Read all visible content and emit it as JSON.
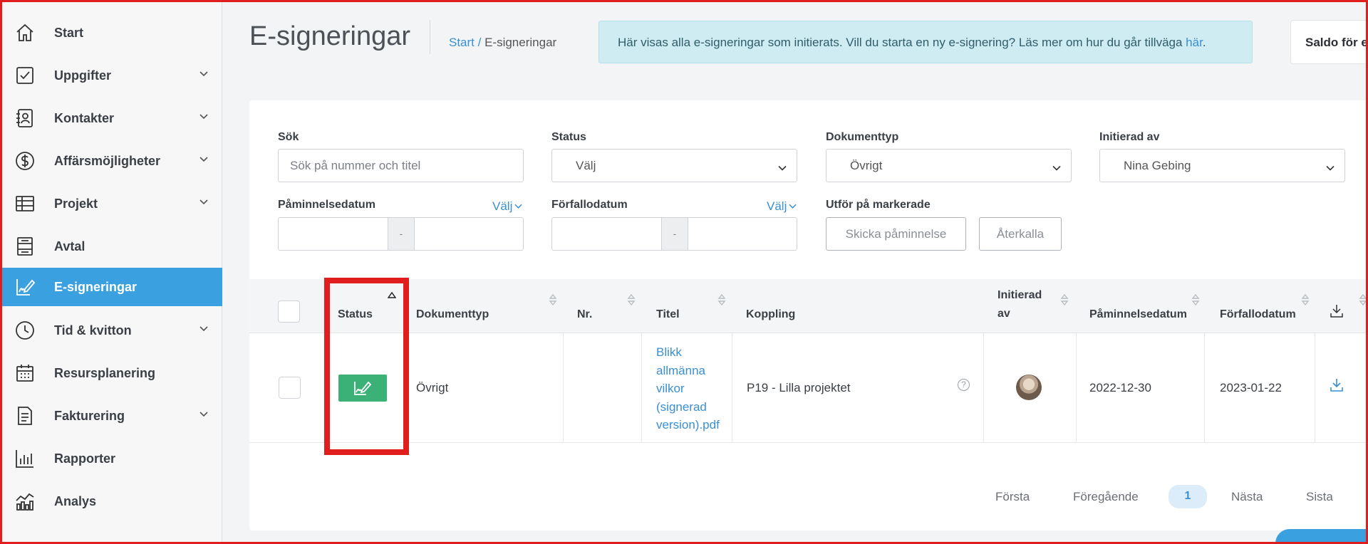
{
  "sidebar": {
    "items": [
      {
        "label": "Start",
        "icon": "home-icon",
        "has_chevron": false,
        "active": false
      },
      {
        "label": "Uppgifter",
        "icon": "checkbox-icon",
        "has_chevron": true,
        "active": false
      },
      {
        "label": "Kontakter",
        "icon": "contacts-icon",
        "has_chevron": true,
        "active": false
      },
      {
        "label": "Affärsmöjligheter",
        "icon": "dollar-icon",
        "has_chevron": true,
        "active": false
      },
      {
        "label": "Projekt",
        "icon": "table-icon",
        "has_chevron": true,
        "active": false
      },
      {
        "label": "Avtal",
        "icon": "contract-icon",
        "has_chevron": false,
        "active": false
      },
      {
        "label": "E-signeringar",
        "icon": "signature-icon",
        "has_chevron": false,
        "active": true
      },
      {
        "label": "Tid & kvitton",
        "icon": "clock-icon",
        "has_chevron": true,
        "active": false
      },
      {
        "label": "Resursplanering",
        "icon": "calendar-icon",
        "has_chevron": false,
        "active": false
      },
      {
        "label": "Fakturering",
        "icon": "document-icon",
        "has_chevron": true,
        "active": false
      },
      {
        "label": "Rapporter",
        "icon": "bar-chart-icon",
        "has_chevron": false,
        "active": false
      },
      {
        "label": "Analys",
        "icon": "analytics-icon",
        "has_chevron": false,
        "active": false
      }
    ]
  },
  "header": {
    "title": "E-signeringar",
    "breadcrumb_start": "Start",
    "breadcrumb_sep": " / ",
    "breadcrumb_current": "E-signeringar",
    "info_text": "Här visas alla e-signeringar som initierats. Vill du starta en ny e-signering? Läs mer om hur du går tillväga ",
    "info_link": "här",
    "info_end": ".",
    "saldo": "Saldo för e-signeringar"
  },
  "filters": {
    "search_label": "Sök",
    "search_placeholder": "Sök på nummer och titel",
    "status_label": "Status",
    "status_value": "Välj",
    "doctype_label": "Dokumenttyp",
    "doctype_value": "Övrigt",
    "initiated_label": "Initierad av",
    "initiated_value": "Nina Gebing",
    "reminder_label": "Påminnelsedatum",
    "reminder_pick": "Välj",
    "due_label": "Förfallodatum",
    "due_pick": "Välj",
    "range_sep": "-",
    "bulk_label": "Utför på markerade",
    "send_reminder": "Skicka påminnelse",
    "revoke": "Återkalla"
  },
  "table": {
    "headers": {
      "status": "Status",
      "doctype": "Dokumenttyp",
      "nr": "Nr.",
      "title": "Titel",
      "link": "Koppling",
      "initiated_1": "Initierad",
      "initiated_2": "av",
      "reminder": "Påminnelsedatum",
      "due": "Förfallodatum"
    },
    "rows": [
      {
        "status_icon": "signature-icon",
        "status_color": "#3bb077",
        "doctype": "Övrigt",
        "nr": "",
        "title_lines": [
          "Blikk",
          "allmänna",
          "vilkor",
          "(signerad",
          "version).pdf"
        ],
        "link": "P19 - Lilla projektet",
        "reminder": "2022-12-30",
        "due": "2023-01-22"
      }
    ]
  },
  "pagination": {
    "first": "Första",
    "prev": "Föregående",
    "current": "1",
    "next": "Nästa",
    "last": "Sista"
  },
  "colors": {
    "accent": "#3aa0df",
    "status_green": "#3bb077",
    "highlight": "#e01e1e",
    "banner_bg": "#cfecf2"
  }
}
